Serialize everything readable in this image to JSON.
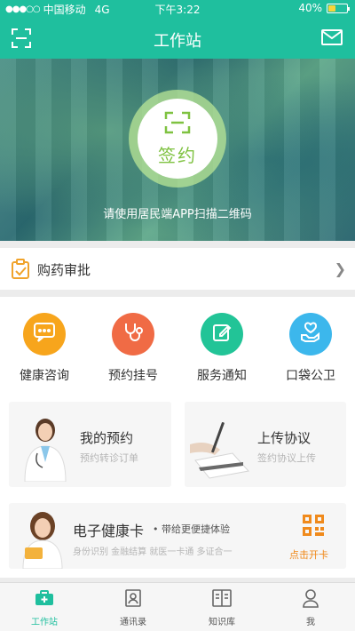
{
  "status_bar": {
    "carrier": "中国移动",
    "network": "4G",
    "time": "下午3:22",
    "battery": "40%",
    "battery_level": 0.4
  },
  "header": {
    "title": "工作站"
  },
  "hero": {
    "sign_label": "签约",
    "caption": "请使用居民端APP扫描二维码"
  },
  "approval": {
    "label": "购药审批"
  },
  "quick_actions": [
    {
      "label": "健康咨询",
      "color": "#f7a51c",
      "icon": "chat-icon"
    },
    {
      "label": "预约挂号",
      "color": "#f06b45",
      "icon": "stethoscope-icon"
    },
    {
      "label": "服务通知",
      "color": "#22c497",
      "icon": "edit-icon"
    },
    {
      "label": "口袋公卫",
      "color": "#3cb7ec",
      "icon": "heart-hand-icon"
    }
  ],
  "cards": {
    "appointment": {
      "title": "我的预约",
      "subtitle": "预约转诊订单"
    },
    "upload": {
      "title": "上传协议",
      "subtitle": "签约协议上传"
    },
    "health_card": {
      "title": "电子健康卡",
      "tagline": "• 带给更便捷体验",
      "features": "身份识别  金融结算  就医一卡通  多证合一",
      "action": "点击开卡"
    }
  },
  "tabs": [
    {
      "label": "工作站",
      "active": true
    },
    {
      "label": "通讯录",
      "active": false
    },
    {
      "label": "知识库",
      "active": false
    },
    {
      "label": "我",
      "active": false
    }
  ],
  "colors": {
    "brand": "#1fbf9e",
    "accent_orange": "#f08a1c"
  }
}
